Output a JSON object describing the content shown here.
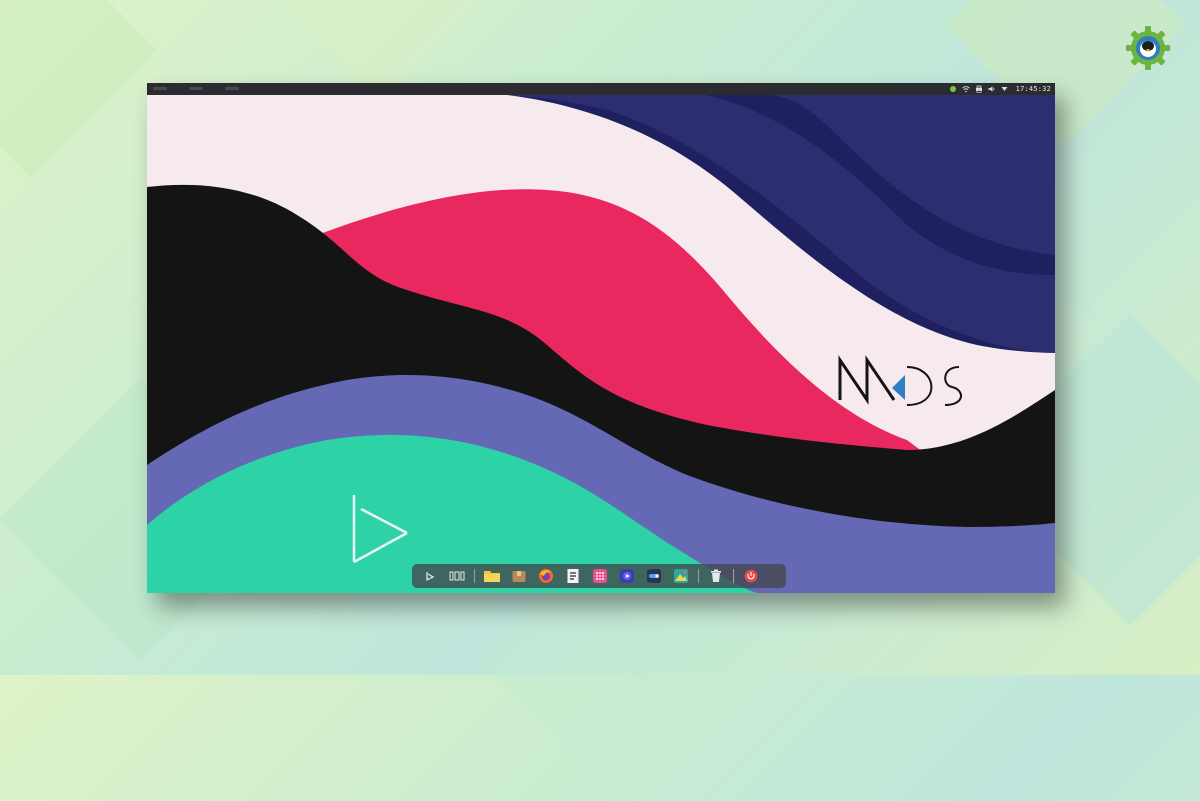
{
  "clock": {
    "time": "17:45:32"
  },
  "wallpaper": {
    "logo": "MKOS",
    "colors": {
      "navy": "#1f2060",
      "indigo": "#2d2e6f",
      "blush": "#f6eaee",
      "black": "#141414",
      "crimson": "#e9285f",
      "periwinkle": "#6468b5",
      "teal": "#2dd3a6"
    }
  },
  "tray_icons": [
    "network-icon",
    "wifi-icon",
    "printer-icon",
    "volume-icon",
    "chevron-down-icon"
  ],
  "dock": {
    "items": [
      {
        "name": "launcher-button",
        "icon": "play-triangle-icon"
      },
      {
        "name": "multitasking-button",
        "icon": "workspaces-icon"
      },
      {
        "name": "file-manager-button",
        "icon": "folder-icon"
      },
      {
        "name": "package-manager-button",
        "icon": "package-icon"
      },
      {
        "name": "firefox-button",
        "icon": "firefox-icon"
      },
      {
        "name": "notes-button",
        "icon": "notes-icon"
      },
      {
        "name": "grid-app-button",
        "icon": "grid-app-icon"
      },
      {
        "name": "video-player-button",
        "icon": "video-player-icon"
      },
      {
        "name": "toggle-app-button",
        "icon": "toggle-app-icon"
      },
      {
        "name": "image-viewer-button",
        "icon": "image-viewer-icon"
      },
      {
        "name": "trash-button",
        "icon": "trash-icon"
      },
      {
        "name": "power-button",
        "icon": "power-icon"
      }
    ]
  }
}
